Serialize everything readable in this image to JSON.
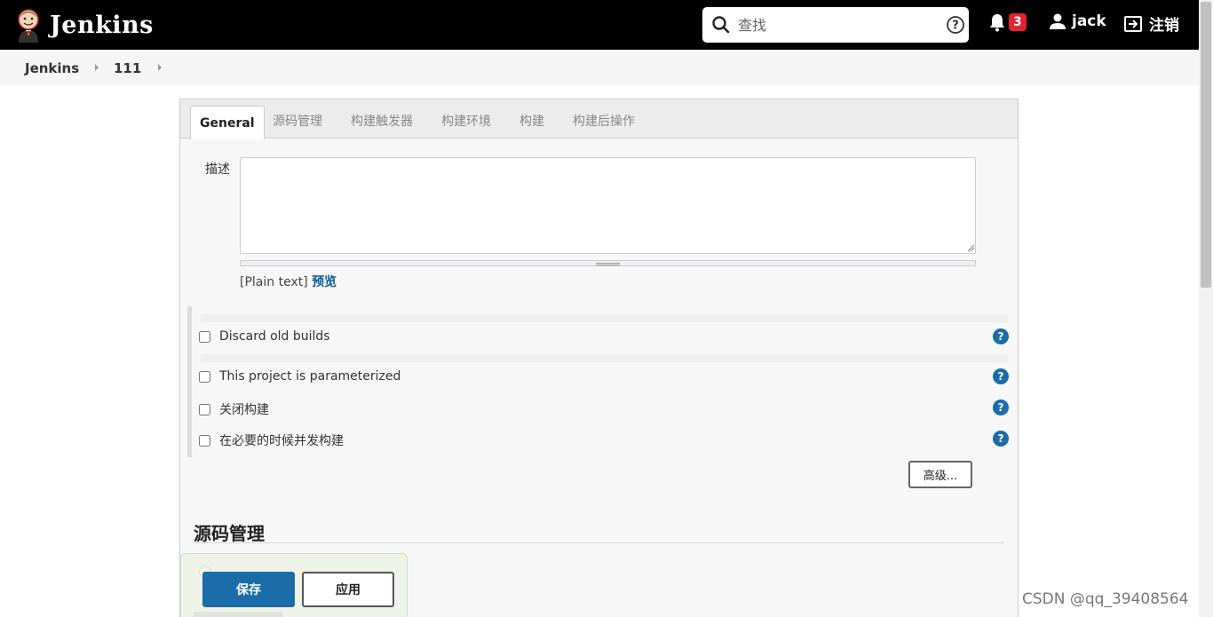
{
  "header": {
    "app_name": "Jenkins",
    "search": {
      "placeholder": "查找"
    },
    "notifications_count": "3",
    "user": "jack",
    "logout_label": "注销"
  },
  "breadcrumb": {
    "items": [
      "Jenkins",
      "111"
    ]
  },
  "tabs": [
    {
      "label": "General",
      "active": true
    },
    {
      "label": "源码管理"
    },
    {
      "label": "构建触发器"
    },
    {
      "label": "构建环境"
    },
    {
      "label": "构建"
    },
    {
      "label": "构建后操作"
    }
  ],
  "general": {
    "description_label": "描述",
    "description_value": "",
    "plain_text": "[Plain text]",
    "preview_link": "预览",
    "options": [
      {
        "label": "Discard old builds",
        "checked": false
      },
      {
        "label": "This project is parameterized",
        "checked": false
      },
      {
        "label": "关闭构建",
        "checked": false
      },
      {
        "label": "在必要的时候并发构建",
        "checked": false
      }
    ],
    "help_symbol": "?",
    "advanced_button": "高级..."
  },
  "scm_section": {
    "title": "源码管理"
  },
  "actions": {
    "save": "保存",
    "apply": "应用"
  },
  "watermark": "CSDN @qq_39408564",
  "colors": {
    "header_bg": "#000000",
    "accent": "#1a6da8",
    "badge": "#e0232f"
  }
}
